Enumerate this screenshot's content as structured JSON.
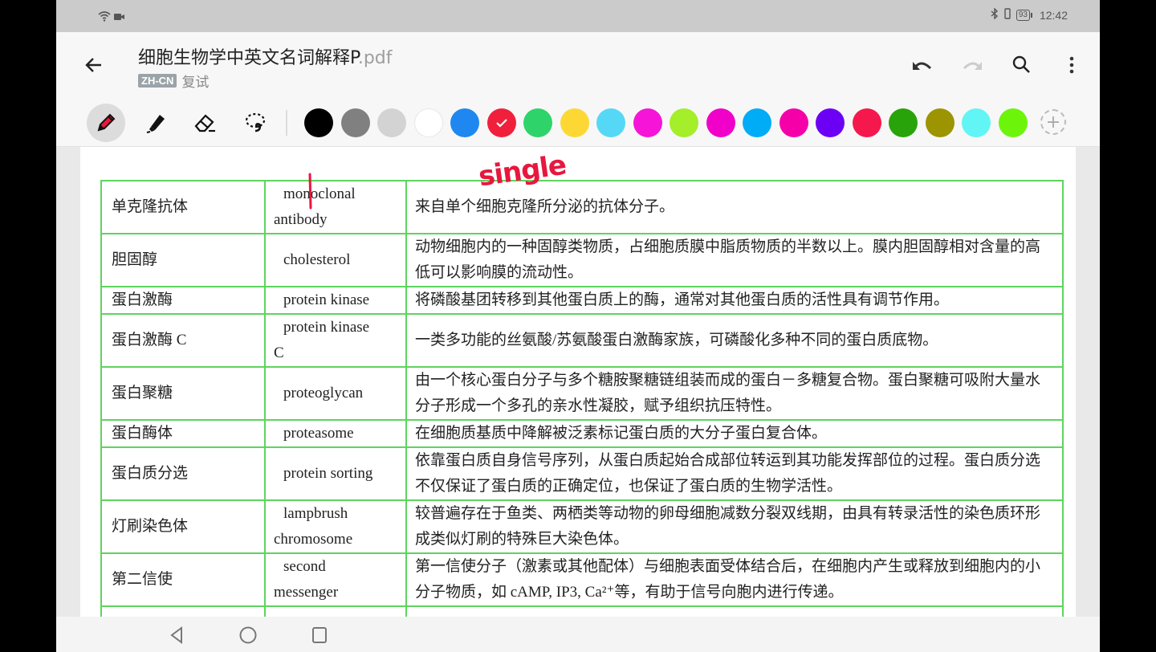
{
  "status_bar": {
    "time": "12:42",
    "battery": "93",
    "left_icons": [
      "wifi-icon",
      "screen-record-icon"
    ],
    "right_icons": [
      "bluetooth-icon",
      "vibrate-icon",
      "battery-icon"
    ]
  },
  "app_bar": {
    "title": "细胞生物学中英文名词解释P",
    "title_ext": ".pdf",
    "language_badge": "ZH-CN",
    "tag": "复试",
    "actions": [
      "undo",
      "redo",
      "search",
      "more"
    ]
  },
  "toolbar": {
    "tools": [
      {
        "name": "pen",
        "active": true
      },
      {
        "name": "highlighter",
        "active": false
      },
      {
        "name": "eraser",
        "active": false
      },
      {
        "name": "lasso",
        "active": false
      }
    ],
    "colors": [
      "#000000",
      "#808080",
      "#d3d3d3",
      "#ffffff",
      "#1e88f0",
      "#f0203c",
      "#2ed46a",
      "#fdd835",
      "#55d8f5",
      "#f514d8",
      "#a4ee2a",
      "#f000c8",
      "#00acf5",
      "#f500a8",
      "#6c00f5",
      "#f5184c",
      "#28a40a",
      "#9c9400",
      "#62f5f5",
      "#6cf50a"
    ],
    "selected_color_index": 5,
    "add_color_label": "+"
  },
  "annotations": {
    "handwritten_text": "single",
    "ink_color": "#e8173e"
  },
  "table": {
    "rows": [
      {
        "zh": "单克隆抗体",
        "en1": "monoclonal",
        "en2": "antibody",
        "def": "来自单个细胞克隆所分泌的抗体分子。"
      },
      {
        "zh": "胆固醇",
        "en1": "cholesterol",
        "en2": "",
        "def": "动物细胞内的一种固醇类物质，占细胞质膜中脂质物质的半数以上。膜内胆固醇相对含量的高低可以影响膜的流动性。"
      },
      {
        "zh": "蛋白激酶",
        "en1": "protein kinase",
        "en2": "",
        "def": "将磷酸基团转移到其他蛋白质上的酶，通常对其他蛋白质的活性具有调节作用。"
      },
      {
        "zh": "蛋白激酶 C",
        "en1": "protein kinase",
        "en2": "C",
        "def": "一类多功能的丝氨酸/苏氨酸蛋白激酶家族，可磷酸化多种不同的蛋白质底物。"
      },
      {
        "zh": "蛋白聚糖",
        "en1": "proteoglycan",
        "en2": "",
        "def": "由一个核心蛋白分子与多个糖胺聚糖链组装而成的蛋白－多糖复合物。蛋白聚糖可吸附大量水分子形成一个多孔的亲水性凝胶，赋予组织抗压特性。"
      },
      {
        "zh": "蛋白酶体",
        "en1": "proteasome",
        "en2": "",
        "def": "在细胞质基质中降解被泛素标记蛋白质的大分子蛋白复合体。"
      },
      {
        "zh": "蛋白质分选",
        "en1": "protein sorting",
        "en2": "",
        "def": "依靠蛋白质自身信号序列，从蛋白质起始合成部位转运到其功能发挥部位的过程。蛋白质分选不仅保证了蛋白质的正确定位，也保证了蛋白质的生物学活性。"
      },
      {
        "zh": "灯刷染色体",
        "en1": "lampbrush",
        "en2": "chromosome",
        "def": "较普遍存在于鱼类、两栖类等动物的卵母细胞减数分裂双线期，由具有转录活性的染色质环形成类似灯刷的特殊巨大染色体。"
      },
      {
        "zh": "第二信使",
        "en1": "second",
        "en2": "messenger",
        "def": "第一信使分子（激素或其他配体）与细胞表面受体结合后，在细胞内产生或释放到细胞内的小分子物质，如 cAMP, IP3, Ca²⁺等，有助于信号向胞内进行传递。"
      }
    ]
  },
  "nav_bar": {
    "buttons": [
      "back",
      "home",
      "recents"
    ]
  }
}
